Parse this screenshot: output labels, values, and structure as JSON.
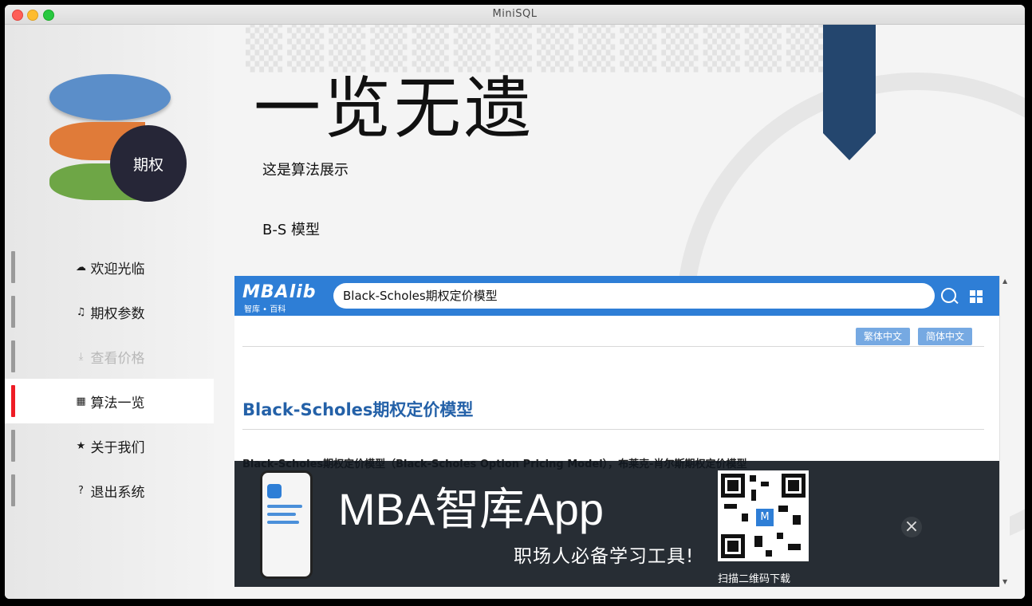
{
  "window": {
    "title": "MiniSQL"
  },
  "sidebar": {
    "logo_badge": "期权",
    "items": [
      {
        "label": "欢迎光临",
        "icon": "cloud-icon",
        "glyph": "☁",
        "state": "normal"
      },
      {
        "label": "期权参数",
        "icon": "music-note-icon",
        "glyph": "♫",
        "state": "normal"
      },
      {
        "label": "查看价格",
        "icon": "download-icon",
        "glyph": "⤓",
        "state": "disabled"
      },
      {
        "label": "算法一览",
        "icon": "film-icon",
        "glyph": "▦",
        "state": "active"
      },
      {
        "label": "关于我们",
        "icon": "star-icon",
        "glyph": "★",
        "state": "normal"
      },
      {
        "label": "退出系统",
        "icon": "question-icon",
        "glyph": "?",
        "state": "normal"
      }
    ]
  },
  "main": {
    "title": "一览无遗",
    "subtitle": "这是算法展示",
    "section_label": "B-S 模型"
  },
  "browser": {
    "logo": "MBAlib",
    "logo_sub": "智库 • 百科",
    "search_value": "Black-Scholes期权定价模型",
    "lang_traditional": "繁体中文",
    "lang_simplified": "简体中文",
    "article_title": "Black-Scholes期权定价模型",
    "article_intro": "Black-Scholes期权定价模型（Black-Scholes Option Pricing Model），布莱克-肖尔斯期权定价模型"
  },
  "ad": {
    "title": "MBA智库App",
    "subtitle": "职场人必备学习工具!",
    "qr_label": "扫描二维码下载",
    "close": "×"
  },
  "colors": {
    "accent_active": "#ee1c25",
    "mba_blue": "#2e7ed6",
    "title_blue": "#2461a8",
    "ribbon": "#24466e"
  }
}
